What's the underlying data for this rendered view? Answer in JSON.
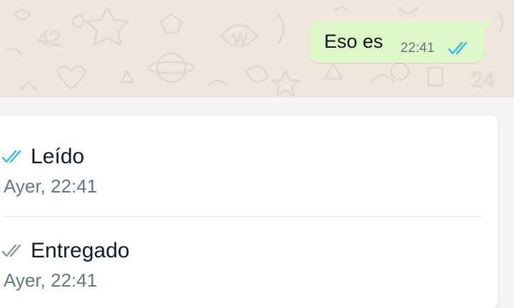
{
  "message": {
    "text": "Eso es",
    "time": "22:41",
    "status_icon": "double-check-read-icon"
  },
  "info": {
    "read": {
      "label": "Leído",
      "time": "Ayer, 22:41",
      "icon": "double-check-read-icon"
    },
    "delivered": {
      "label": "Entregado",
      "time": "Ayer, 22:41",
      "icon": "double-check-delivered-icon"
    }
  },
  "colors": {
    "chat_background": "#efe7dd",
    "bubble": "#dcf8c6",
    "read_check": "#34b7f1",
    "delivered_check": "#8696a0",
    "secondary_text": "#667781"
  }
}
